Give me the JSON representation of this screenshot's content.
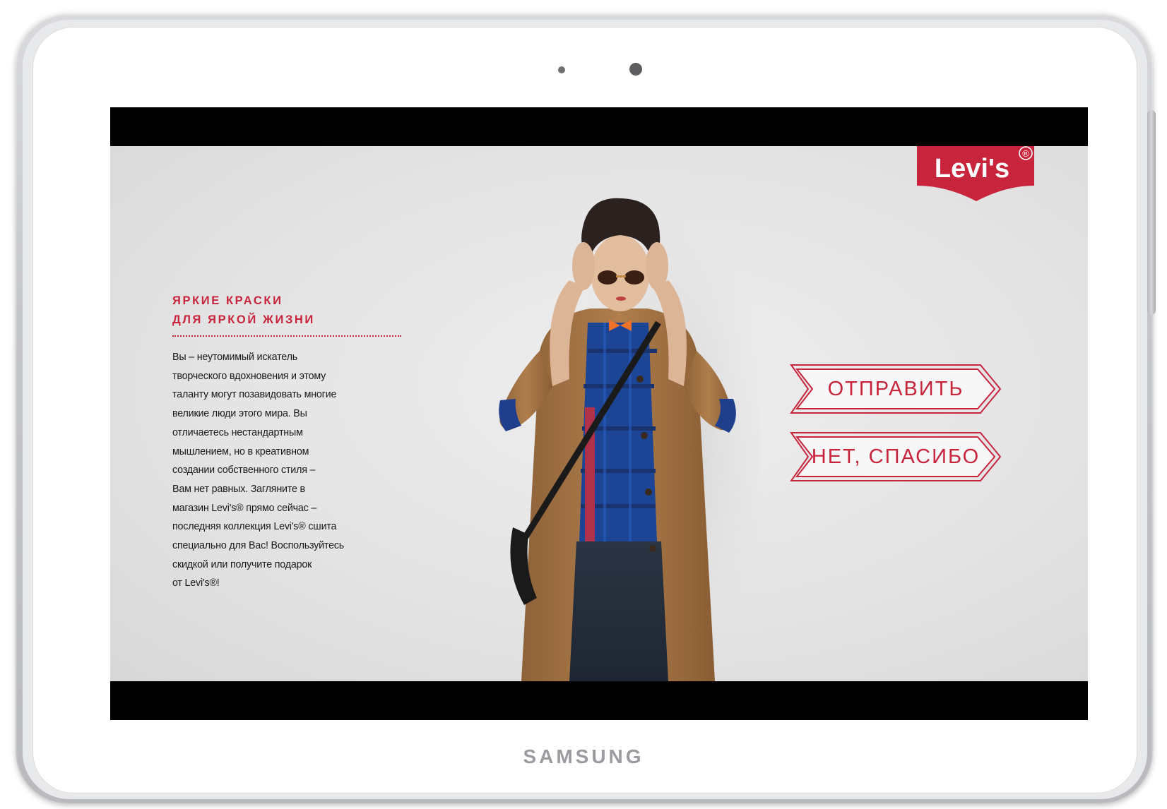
{
  "device": {
    "brand": "SAMSUNG"
  },
  "app": {
    "logo_text": "Levi's",
    "registered_mark": "®",
    "headline_lines": [
      "ЯРКИЕ КРАСКИ",
      "ДЛЯ ЯРКОЙ ЖИЗНИ"
    ],
    "body_lines": [
      "Вы – неутомимый искатель",
      "творческого вдохновения и этому",
      "таланту могут позавидовать многие",
      "великие люди этого мира. Вы",
      "отличаетесь нестандартным",
      "мышлением, но в креативном",
      "создании собственного стиля –",
      "Вам нет равных. Загляните в",
      "магазин Levi's® прямо сейчас –",
      "последняя коллекция Levi's® сшита",
      "специально для Вас! Воспользуйтесь",
      "скидкой или получите подарок",
      "от Levi's®!"
    ],
    "buttons": {
      "send_label": "ОТПРАВИТЬ",
      "decline_label": "НЕТ, СПАСИБО"
    }
  },
  "colors": {
    "accent": "#c8253d",
    "screen_bezel": "#000000",
    "app_background": "#e6e6e7"
  },
  "icons": {
    "logo": "levis-batwing-logo"
  }
}
